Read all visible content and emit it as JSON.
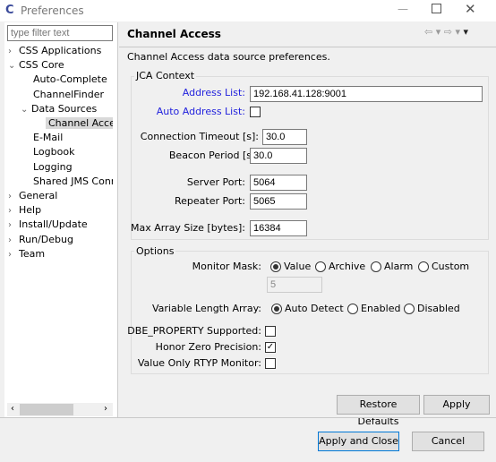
{
  "window": {
    "title": "Preferences",
    "icon": "eclipse-css-icon"
  },
  "sidebar": {
    "filter_placeholder": "type filter text",
    "items": [
      {
        "label": "CSS Applications",
        "level": 0,
        "expander": "collapsed"
      },
      {
        "label": "CSS Core",
        "level": 0,
        "expander": "expanded"
      },
      {
        "label": "Auto-Complete",
        "level": 1
      },
      {
        "label": "ChannelFinder",
        "level": 1
      },
      {
        "label": "Data Sources",
        "level": 1,
        "expander": "expanded"
      },
      {
        "label": "Channel Access",
        "level": 2,
        "selected": true
      },
      {
        "label": "E-Mail",
        "level": 1
      },
      {
        "label": "Logbook",
        "level": 1
      },
      {
        "label": "Logging",
        "level": 1
      },
      {
        "label": "Shared JMS Connection",
        "level": 1
      },
      {
        "label": "General",
        "level": 0,
        "expander": "collapsed"
      },
      {
        "label": "Help",
        "level": 0,
        "expander": "collapsed"
      },
      {
        "label": "Install/Update",
        "level": 0,
        "expander": "collapsed"
      },
      {
        "label": "Run/Debug",
        "level": 0,
        "expander": "collapsed"
      },
      {
        "label": "Team",
        "level": 0,
        "expander": "collapsed"
      }
    ]
  },
  "page": {
    "title": "Channel Access",
    "description": "Channel Access data source preferences.",
    "jca": {
      "title": "JCA Context",
      "address_list_label": "Address List:",
      "address_list": "192.168.41.128:9001",
      "auto_address_label": "Auto Address List:",
      "auto_address": false,
      "conn_timeout_label": "Connection Timeout [s]:",
      "conn_timeout": "30.0",
      "beacon_label": "Beacon Period [s]:",
      "beacon": "30.0",
      "server_port_label": "Server Port:",
      "server_port": "5064",
      "repeater_port_label": "Repeater Port:",
      "repeater_port": "5065",
      "max_array_label": "Max Array Size [bytes]:",
      "max_array": "16384"
    },
    "options": {
      "title": "Options",
      "monitor_mask_label": "Monitor Mask:",
      "monitor_mask_options": [
        "Value",
        "Archive",
        "Alarm",
        "Custom"
      ],
      "monitor_mask_selected": "Value",
      "custom_value": "5",
      "var_len_label": "Variable Length Array:",
      "var_len_options": [
        "Auto Detect",
        "Enabled",
        "Disabled"
      ],
      "var_len_selected": "Auto Detect",
      "dbe_label": "DBE_PROPERTY Supported:",
      "dbe": false,
      "honor_zero_label": "Honor Zero Precision:",
      "honor_zero": true,
      "value_only_label": "Value Only RTYP Monitor:",
      "value_only": false
    },
    "restore_defaults": "Restore Defaults",
    "apply": "Apply"
  },
  "footer": {
    "apply_close": "Apply and Close",
    "cancel": "Cancel"
  }
}
